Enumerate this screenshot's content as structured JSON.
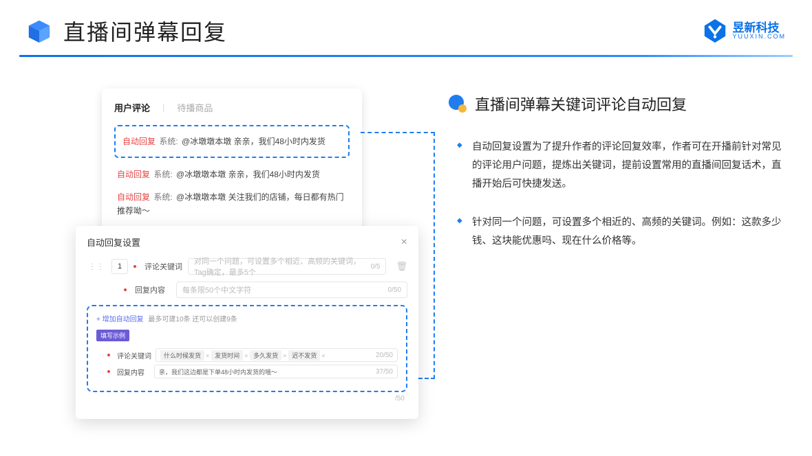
{
  "header": {
    "title": "直播间弹幕回复",
    "logo_name": "昱新科技",
    "logo_sub": "YUUXIN.COM"
  },
  "comments_card": {
    "tab_active": "用户评论",
    "tab_inactive": "待播商品",
    "reply_tag": "自动回复",
    "reply_sys_prefix": "系统:",
    "row1": "@冰墩墩本墩 亲亲，我们48小时内发货",
    "row2": "@冰墩墩本墩 亲亲，我们48小时内发货",
    "row3": "@冰墩墩本墩 关注我们的店铺，每日都有热门推荐呦～"
  },
  "settings_card": {
    "title": "自动回复设置",
    "index": "1",
    "field_keyword_label": "评论关键词",
    "field_keyword_placeholder": "对同一个问题，可设置多个相近、高频的关键词，Tag确定，最多5个",
    "field_keyword_counter": "0/5",
    "field_content_label": "回复内容",
    "field_content_placeholder": "每条限50个中文字符",
    "field_content_counter": "0/50",
    "add_text_link": "+ 增加自动回复",
    "add_text_note": "最多可建10条 还可以创建9条",
    "example_badge": "填写示例",
    "ex_keyword_label": "评论关键词",
    "ex_keyword_tags": [
      "什么时候发货",
      "发货时间",
      "多久发货",
      "迟不发货"
    ],
    "ex_keyword_counter": "20/50",
    "ex_content_label": "回复内容",
    "ex_content_value": "亲，我们这边都是下单48小时内发货的哦～",
    "ex_content_counter": "37/50",
    "outer_counter": "/50"
  },
  "right": {
    "section_title": "直播间弹幕关键词评论自动回复",
    "bullet1": "自动回复设置为了提升作者的评论回复效率，作者可在开播前针对常见的评论用户问题，提炼出关键词，提前设置常用的直播间回复话术，直播开始后可快捷发送。",
    "bullet2": "针对同一个问题，可设置多个相近的、高频的关键词。例如：这款多少钱、这块能优惠吗、现在什么价格等。"
  }
}
